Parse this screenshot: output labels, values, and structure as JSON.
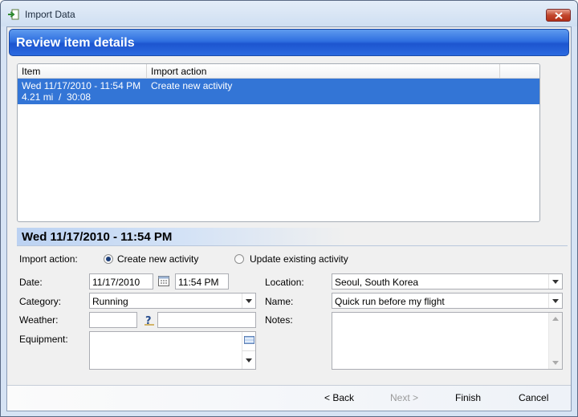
{
  "window": {
    "title": "Import Data",
    "icons": {
      "app": "import-arrow-icon",
      "close": "close-icon"
    }
  },
  "header": {
    "title": "Review item details"
  },
  "list": {
    "columns": [
      "Item",
      "Import action"
    ],
    "rows": [
      {
        "item_line1": "Wed 11/17/2010 - 11:54 PM",
        "item_line2": "4.21 mi  /  30:08",
        "action": "Create new activity",
        "selected": true
      }
    ]
  },
  "details": {
    "section_title": "Wed 11/17/2010 - 11:54 PM",
    "import_action": {
      "label": "Import action:",
      "options": [
        {
          "label": "Create new activity",
          "selected": true
        },
        {
          "label": "Update existing activity",
          "selected": false
        }
      ]
    },
    "date": {
      "label": "Date:",
      "date_value": "11/17/2010",
      "time_value": "11:54 PM"
    },
    "category": {
      "label": "Category:",
      "value": "Running"
    },
    "weather": {
      "label": "Weather:",
      "value": "",
      "note": ""
    },
    "equipment": {
      "label": "Equipment:"
    },
    "location": {
      "label": "Location:",
      "value": "Seoul, South Korea"
    },
    "name": {
      "label": "Name:",
      "value": "Quick run before my flight"
    },
    "notes": {
      "label": "Notes:",
      "value": ""
    }
  },
  "footer": {
    "back": "< Back",
    "next": "Next >",
    "finish": "Finish",
    "cancel": "Cancel"
  },
  "colors": {
    "header_blue": "#2f6fe0",
    "selection_blue": "#3375d6",
    "close_red": "#c2482e"
  }
}
